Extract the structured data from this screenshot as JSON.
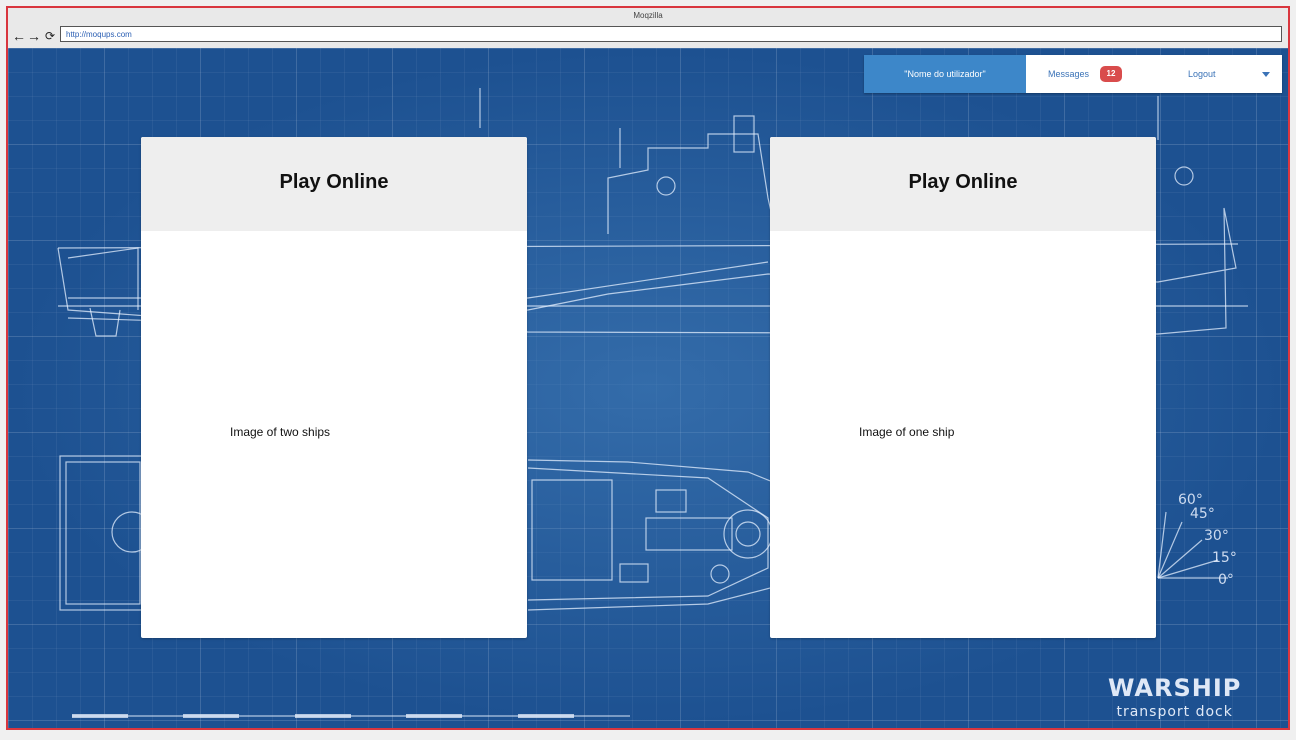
{
  "browser": {
    "title": "Moqzilla",
    "url": "http://moqups.com"
  },
  "userbar": {
    "user_name": "\"Nome do utilizador\"",
    "messages_label": "Messages",
    "messages_count": "12",
    "logout_label": "Logout"
  },
  "cards": [
    {
      "title": "Play Online",
      "image_label": "Image of two ships"
    },
    {
      "title": "Play Online",
      "image_label": "Image of one ship"
    }
  ],
  "background": {
    "logo_title": "WARSHIP",
    "logo_subtitle": "transport dock",
    "angle_marks": [
      "60°",
      "45°",
      "30°",
      "15°",
      "0°"
    ],
    "accent_color": "#3d87c9",
    "badge_color": "#d94c4c",
    "frame_color": "#d9363e"
  }
}
